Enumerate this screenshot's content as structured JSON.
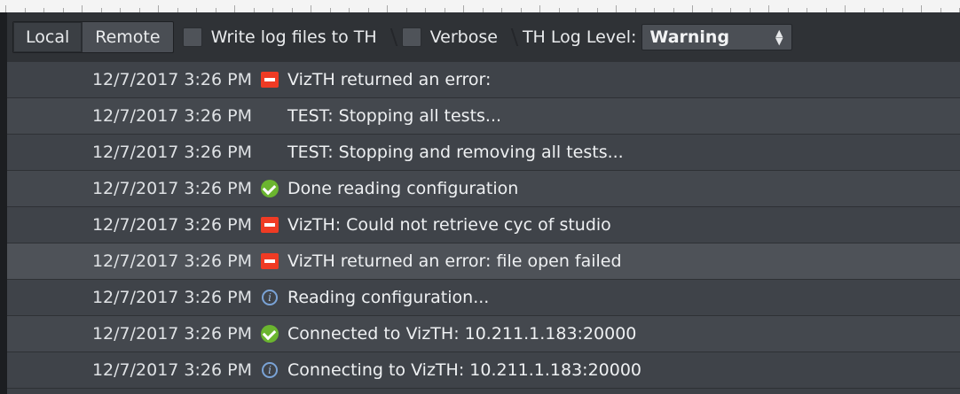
{
  "toolbar": {
    "tabs": [
      {
        "label": "Local",
        "active": true
      },
      {
        "label": "Remote",
        "active": false
      }
    ],
    "write_log_files": {
      "label": "Write log files to TH",
      "checked": false
    },
    "verbose": {
      "label": "Verbose",
      "checked": false
    },
    "log_level": {
      "label": "TH Log Level:",
      "value": "Warning"
    }
  },
  "log": {
    "rows": [
      {
        "timestamp": "12/7/2017 3:26 PM",
        "icon": "error-icon",
        "message": "VizTH returned an error:"
      },
      {
        "timestamp": "12/7/2017 3:26 PM",
        "icon": "",
        "message": "TEST: Stopping all tests..."
      },
      {
        "timestamp": "12/7/2017 3:26 PM",
        "icon": "",
        "message": "TEST: Stopping and removing all tests..."
      },
      {
        "timestamp": "12/7/2017 3:26 PM",
        "icon": "success-icon",
        "message": "Done reading configuration"
      },
      {
        "timestamp": "12/7/2017 3:26 PM",
        "icon": "error-icon",
        "message": "VizTH: Could not retrieve cyc of studio"
      },
      {
        "timestamp": "12/7/2017 3:26 PM",
        "icon": "error-icon",
        "message": "VizTH returned an error: file open failed"
      },
      {
        "timestamp": "12/7/2017 3:26 PM",
        "icon": "info-icon",
        "message": "Reading configuration..."
      },
      {
        "timestamp": "12/7/2017 3:26 PM",
        "icon": "success-icon",
        "message": "Connected to VizTH: 10.211.1.183:20000"
      },
      {
        "timestamp": "12/7/2017 3:26 PM",
        "icon": "info-icon",
        "message": "Connecting to VizTH: 10.211.1.183:20000"
      }
    ]
  },
  "colors": {
    "error": "#ef3b24",
    "success": "#6bb52f",
    "info": "#7aa3d6",
    "background": "#3d4147"
  }
}
